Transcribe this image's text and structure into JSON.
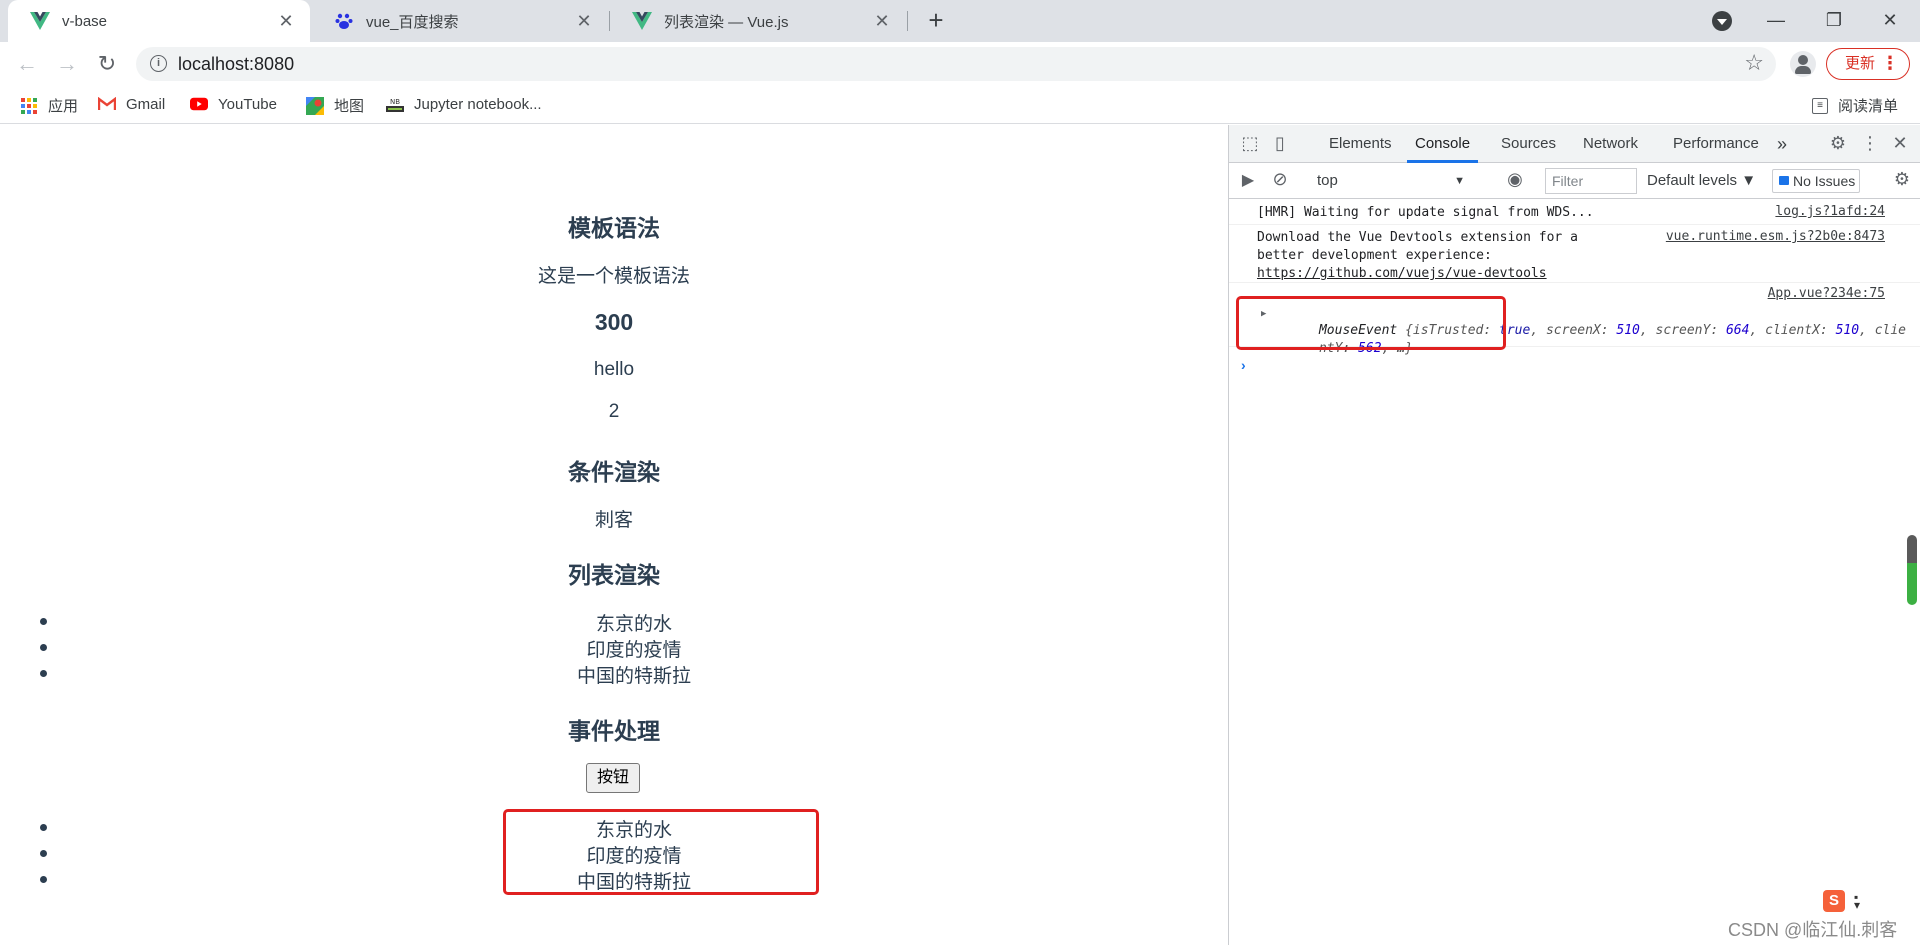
{
  "browser": {
    "tabs": [
      {
        "title": "v-base",
        "favicon": "vue-logo-icon",
        "active": true
      },
      {
        "title": "vue_百度搜索",
        "favicon": "baidu-paw-icon",
        "active": false
      },
      {
        "title": "列表渲染 — Vue.js",
        "favicon": "vue-logo-icon",
        "active": false
      }
    ],
    "new_tab": "+",
    "url": "localhost:8080",
    "update_label": "更新",
    "bookmarks": [
      {
        "label": "应用",
        "icon": "apps-grid-icon"
      },
      {
        "label": "Gmail",
        "icon": "gmail-icon"
      },
      {
        "label": "YouTube",
        "icon": "youtube-icon"
      },
      {
        "label": "地图",
        "icon": "maps-icon"
      },
      {
        "label": "Jupyter notebook...",
        "icon": "jupyter-icon"
      }
    ],
    "reading_list": "阅读清单",
    "colors": {
      "tab_strip": "#dee1e6",
      "accent": "#1a73e8",
      "update_red": "#d93025"
    }
  },
  "page": {
    "template_heading": "模板语法",
    "template_text": "这是一个模板语法",
    "number_heading": "300",
    "hello_text": "hello",
    "count_text": "2",
    "condition_heading": "条件渲染",
    "condition_text": "刺客",
    "list_heading": "列表渲染",
    "list_items": [
      "东京的水",
      "印度的疫情",
      "中国的特斯拉"
    ],
    "event_heading": "事件处理",
    "button_label": "按钮",
    "event_list_items": [
      "东京的水",
      "印度的疫情",
      "中国的特斯拉"
    ],
    "text_color": "#2c3e50"
  },
  "devtools": {
    "tabs": [
      "Elements",
      "Console",
      "Sources",
      "Network",
      "Performance"
    ],
    "active_tab": "Console",
    "more_tabs": "»",
    "context": "top",
    "filter_placeholder": "Filter",
    "levels": "Default levels ▼",
    "issues": "No Issues",
    "messages": {
      "hmr": "[HMR] Waiting for update signal from WDS...",
      "hmr_src": "log.js?1afd:24",
      "vue_line1": "Download the Vue Devtools extension for a",
      "vue_line2": "better development experience:",
      "vue_link": "https://github.com/vuejs/vue-devtools",
      "vue_src": "vue.runtime.esm.js?2b0e:8473",
      "event_src": "App.vue?234e:75",
      "event_name": "MouseEvent",
      "event_line1_a": " {isTrusted: ",
      "event_true": "true",
      "event_line1_b": ", screenX: ",
      "event_sx": "510",
      "event_line1_c": ", screenY: ",
      "event_sy": "664",
      "event_line1_d": ", clientX: ",
      "event_cx": "510",
      "event_line1_e": ", clie",
      "event_line2_a": "ntY: ",
      "event_cy": "562",
      "event_line2_b": ", …}"
    },
    "prompt": "›"
  },
  "watermark": "CSDN @临江仙.刺客",
  "ime_icon": "S"
}
